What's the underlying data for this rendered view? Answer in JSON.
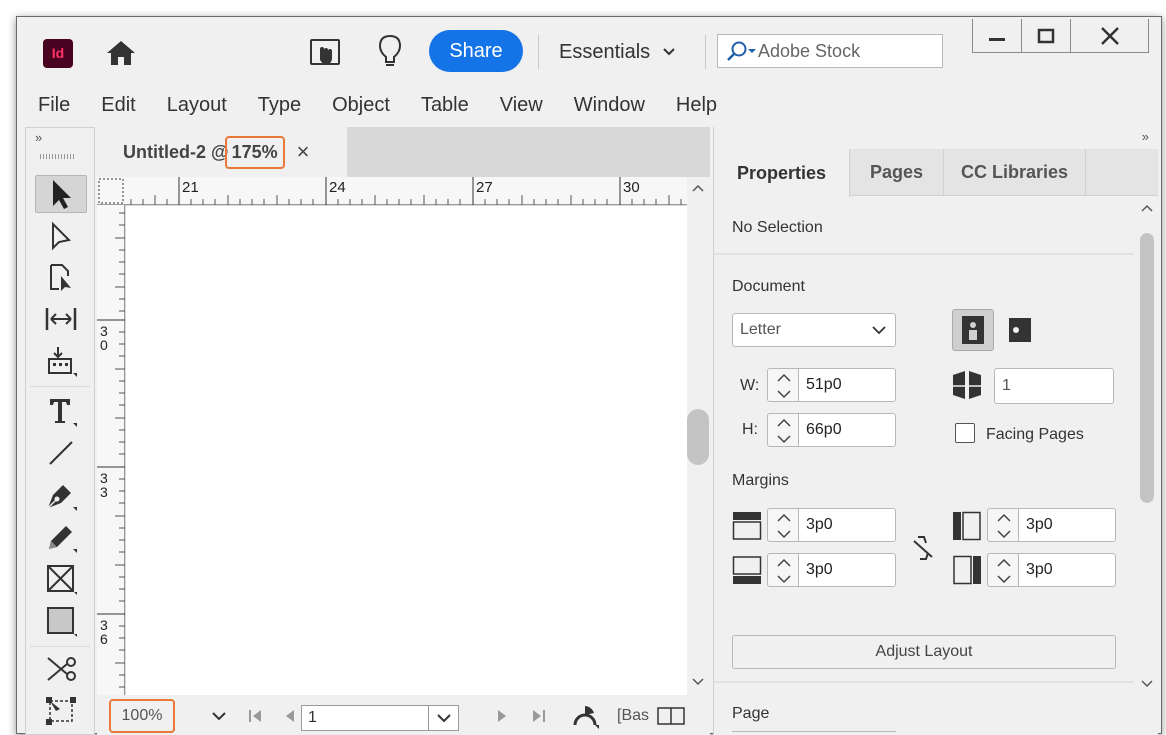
{
  "app": {
    "logo_text": "Id",
    "brand_color": "#49021f",
    "logo_text_color": "#ff3366"
  },
  "topbar": {
    "share_label": "Share",
    "share_color": "#1473e6",
    "workspace_label": "Essentials",
    "search_placeholder": "Adobe Stock",
    "icons": [
      "home-icon",
      "cursor-hand-icon",
      "lightbulb-icon",
      "search-icon",
      "chevron-down-icon"
    ]
  },
  "window_controls": {
    "icons": [
      "minimize-icon",
      "maximize-icon",
      "close-icon"
    ]
  },
  "menu": [
    "File",
    "Edit",
    "Layout",
    "Type",
    "Object",
    "Table",
    "View",
    "Window",
    "Help"
  ],
  "tools": {
    "collapse_label": "»",
    "items": [
      "selection-tool-icon",
      "direct-selection-tool-icon",
      "page-tool-icon",
      "gap-tool-icon",
      "content-collector-icon",
      "type-tool-icon",
      "line-tool-icon",
      "pen-tool-icon",
      "pencil-tool-icon",
      "rectangle-frame-tool-icon",
      "rectangle-tool-icon",
      "scissors-tool-icon",
      "free-transform-tool-icon"
    ]
  },
  "document": {
    "tab_title": "Untitled-2 @",
    "tab_zoom": "175%",
    "tab_close": "×",
    "highlight_color": "#e8793a",
    "ruler_h": [
      "21",
      "24",
      "27",
      "30"
    ],
    "ruler_v": [
      [
        "3",
        "0"
      ],
      [
        "3",
        "3"
      ],
      [
        "3",
        "6"
      ]
    ]
  },
  "statusbar": {
    "zoom": "100%",
    "page": "1",
    "master_label": "[Bas"
  },
  "panel": {
    "collapse_label": "»",
    "tabs": [
      "Properties",
      "Pages",
      "CC Libraries"
    ],
    "no_selection": "No Selection",
    "document_heading": "Document",
    "preset": "Letter",
    "width_label": "W:",
    "width": "51p0",
    "height_label": "H:",
    "height": "66p0",
    "pages_count": "1",
    "facing_pages_label": "Facing Pages",
    "facing_pages_checked": false,
    "margins_heading": "Margins",
    "margin_top": "3p0",
    "margin_bottom": "3p0",
    "margin_inside": "3p0",
    "margin_outside": "3p0",
    "adjust_layout_label": "Adjust Layout",
    "page_heading": "Page"
  }
}
